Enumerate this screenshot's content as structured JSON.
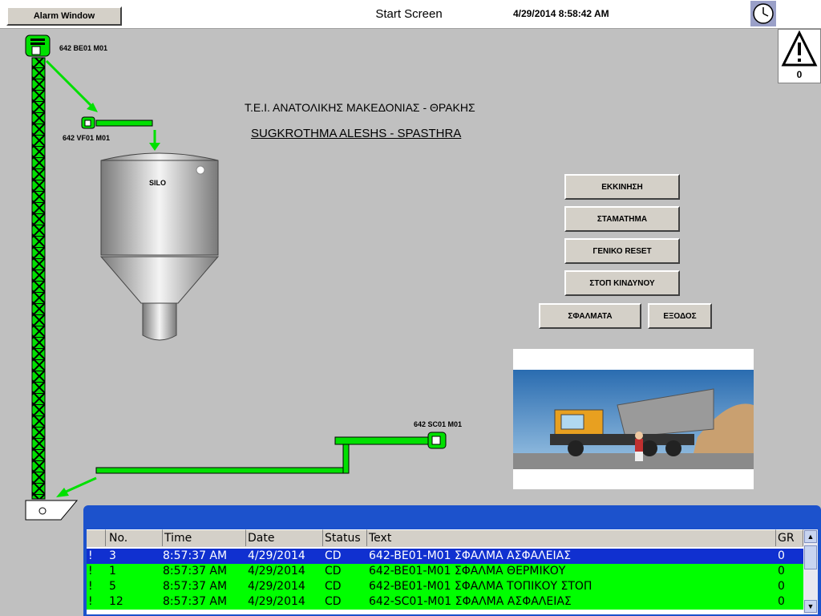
{
  "header": {
    "alarm_window_label": "Alarm Window",
    "screen_title": "Start Screen",
    "datetime": "4/29/2014 8:58:42 AM"
  },
  "warning": {
    "count": "0"
  },
  "labels": {
    "elevator_motor": "642 BE01 M01",
    "feeder_motor": "642 VF01 M01",
    "silo": "SILO",
    "screw_motor": "642 SC01 M01"
  },
  "titles": {
    "organization": "Τ.Ε.Ι. ΑΝΑΤΟΛΙΚΗΣ ΜΑΚΕΔΟΝΙΑΣ - ΘΡΑΚΗΣ",
    "subtitle": "SUGKROTHMA ALESHS - SPASTHRA"
  },
  "buttons": {
    "start": "ΕΚΚΙΝΗΣΗ",
    "stop": "ΣΤΑΜΑΤΗΜΑ",
    "reset": "ΓΕΝΙΚΟ RESET",
    "emergency": "ΣΤΟΠ ΚΙΝΔΥΝΟΥ",
    "errors": "ΣΦΑΛΜΑΤΑ",
    "exit": "ΕΞΟΔΟΣ"
  },
  "alarms": {
    "columns": {
      "no": "No.",
      "time": "Time",
      "date": "Date",
      "status": "Status",
      "text": "Text",
      "gr": "GR"
    },
    "rows": [
      {
        "flag": "!",
        "no": "3",
        "time": "8:57:37 AM",
        "date": "4/29/2014",
        "status": "CD",
        "text": "642-BE01-M01 ΣΦΑΛΜΑ ΑΣΦΑΛΕΙΑΣ",
        "gr": "0"
      },
      {
        "flag": "!",
        "no": "1",
        "time": "8:57:37 AM",
        "date": "4/29/2014",
        "status": "CD",
        "text": "642-BE01-M01 ΣΦΑΛΜΑ ΘΕΡΜΙΚΟΥ",
        "gr": "0"
      },
      {
        "flag": "!",
        "no": "5",
        "time": "8:57:37 AM",
        "date": "4/29/2014",
        "status": "CD",
        "text": "642-BE01-M01 ΣΦΑΛΜΑ ΤΟΠΙΚΟΥ ΣΤΟΠ",
        "gr": "0"
      },
      {
        "flag": "!",
        "no": "12",
        "time": "8:57:37 AM",
        "date": "4/29/2014",
        "status": "CD",
        "text": "642-SC01-M01 ΣΦΑΛΜΑ ΑΣΦΑΛΕΙΑΣ",
        "gr": "0"
      }
    ]
  },
  "colors": {
    "running_green": "#00ff00",
    "selected_row": "#1030d0",
    "alarm_panel": "#1c52cc"
  }
}
